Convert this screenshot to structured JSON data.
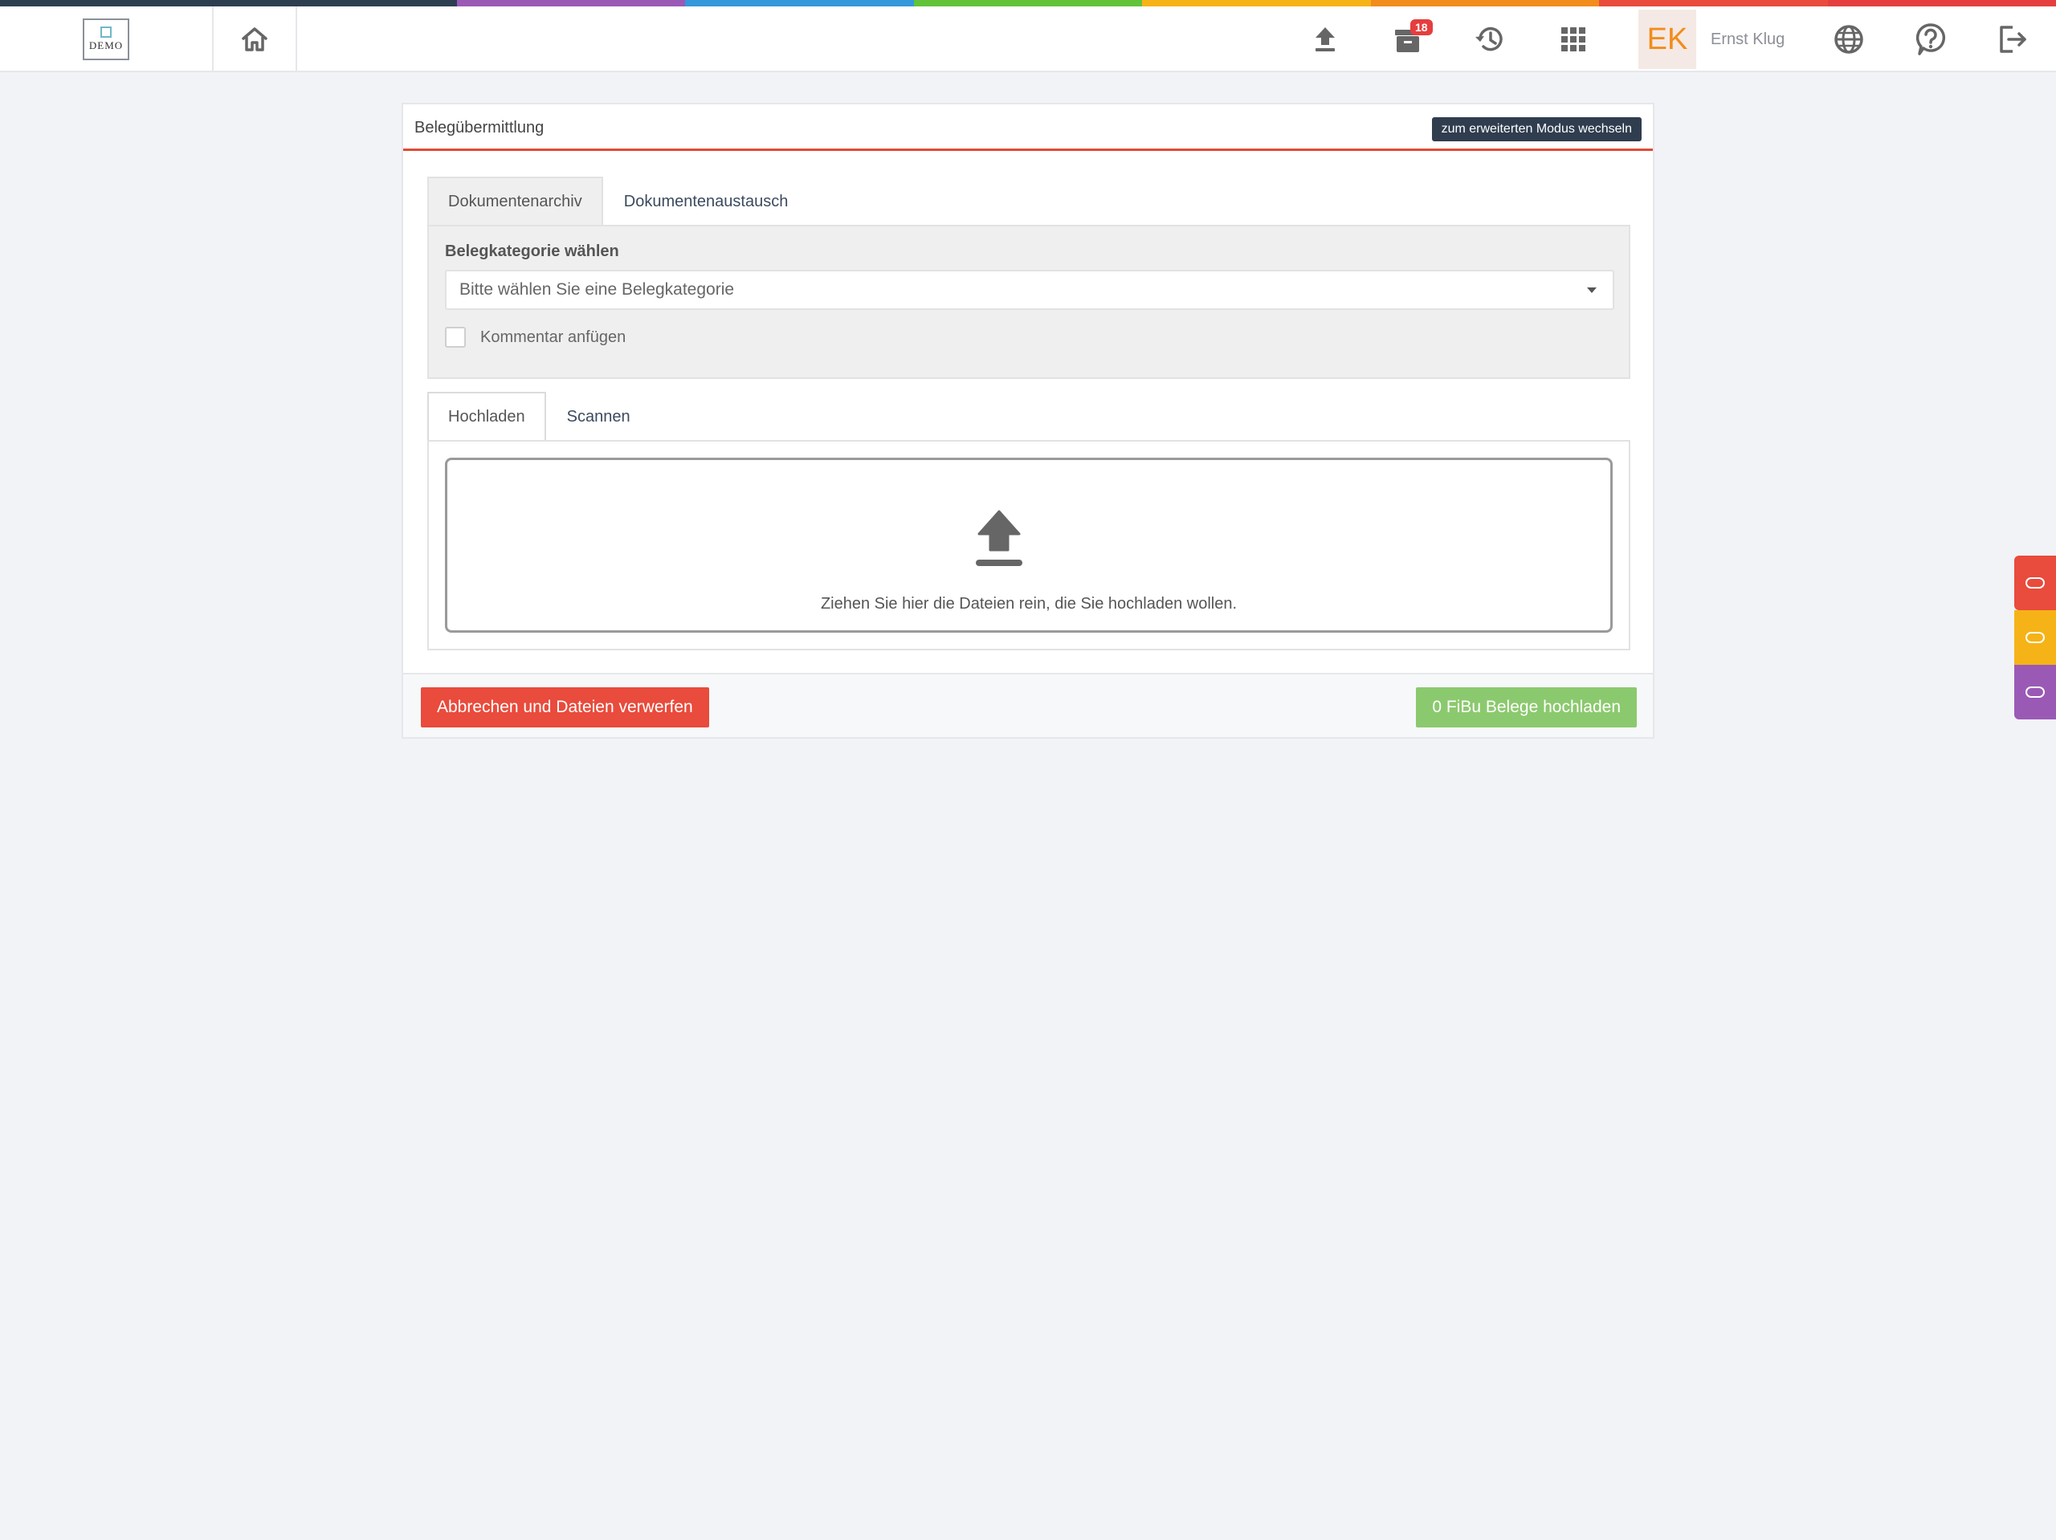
{
  "colors": {
    "stripe": [
      "#2d3e50",
      "#2d3e50",
      "#9b59b6",
      "#3498db",
      "#62c33b",
      "#f6b317",
      "#f28c1c",
      "#e94b3c",
      "#e53e3e"
    ],
    "accent_line": "#e04a35",
    "danger": "#e94b3c",
    "success": "#8bc96e",
    "dark_button": "#2f3d4f",
    "avatar_text": "#f28c1c",
    "side_tabs": [
      "#e94b3c",
      "#f6b317",
      "#9b59b6"
    ]
  },
  "header": {
    "logo_text": "DEMO",
    "icons": [
      "home-icon",
      "upload-icon",
      "archive-icon",
      "history-icon",
      "apps-grid-icon",
      "globe-icon",
      "help-icon",
      "logout-icon"
    ],
    "archive_badge": "18",
    "avatar_initials": "EK",
    "user_name": "Ernst Klug"
  },
  "card": {
    "title": "Belegübermittlung",
    "mode_button": "zum erweiterten Modus wechseln",
    "top_tabs": [
      {
        "label": "Dokumentenarchiv",
        "active": true
      },
      {
        "label": "Dokumentenaustausch",
        "active": false
      }
    ],
    "category_label": "Belegkategorie wählen",
    "category_select_value": "Bitte wählen Sie eine Belegkategorie",
    "comment_checkbox_label": "Kommentar anfügen",
    "comment_checked": false,
    "upload_tabs": [
      {
        "label": "Hochladen",
        "active": true
      },
      {
        "label": "Scannen",
        "active": false
      }
    ],
    "dropzone_text": "Ziehen Sie hier die Dateien rein, die Sie hochladen wollen.",
    "cancel_button": "Abbrechen und Dateien verwerfen",
    "upload_button": "0 FiBu Belege hochladen"
  }
}
